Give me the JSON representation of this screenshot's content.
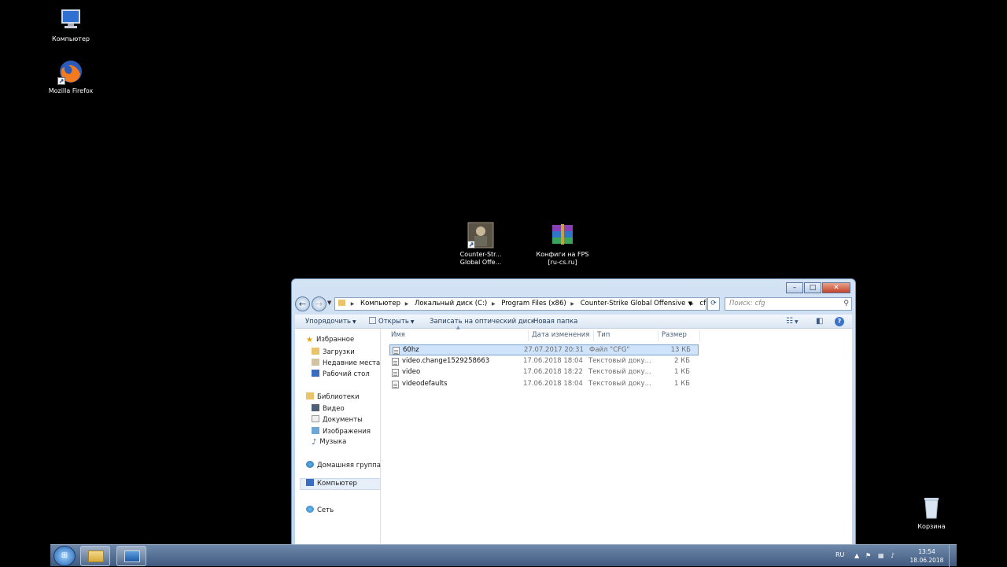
{
  "desktop": {
    "icons": [
      {
        "label": "Компьютер"
      },
      {
        "label": "Mozilla Firefox"
      },
      {
        "label": "Counter-Str... Global Offe..."
      },
      {
        "label": "Конфиги на FPS [ru-cs.ru]"
      },
      {
        "label": "Корзина"
      }
    ]
  },
  "window": {
    "address": {
      "segments": [
        "Компьютер",
        "Локальный диск (C:)",
        "Program Files (x86)",
        "Counter-Strike Global Offensive",
        "cfg"
      ]
    },
    "search_placeholder": "Поиск: cfg",
    "toolbar": {
      "organize": "Упорядочить",
      "open": "Открыть",
      "burn": "Записать на оптический диск",
      "new_folder": "Новая папка"
    },
    "nav": {
      "favorites": "Избранное",
      "downloads": "Загрузки",
      "recent": "Недавние места",
      "desktop": "Рабочий стол",
      "libraries": "Библиотеки",
      "video": "Видео",
      "documents": "Документы",
      "images": "Изображения",
      "music": "Музыка",
      "homegroup": "Домашняя группа",
      "computer": "Компьютер",
      "network": "Сеть"
    },
    "columns": {
      "name": "Имя",
      "date": "Дата изменения",
      "type": "Тип",
      "size": "Размер"
    },
    "files": [
      {
        "name": "60hz",
        "date": "27.07.2017 20:31",
        "type": "Файл \"CFG\"",
        "size": "13 КБ"
      },
      {
        "name": "video.change1529258663",
        "date": "17.06.2018 18:04",
        "type": "Текстовый доку...",
        "size": "2 КБ"
      },
      {
        "name": "video",
        "date": "17.06.2018 18:22",
        "type": "Текстовый доку...",
        "size": "1 КБ"
      },
      {
        "name": "videodefaults",
        "date": "17.06.2018 18:04",
        "type": "Текстовый доку...",
        "size": "1 КБ"
      }
    ]
  },
  "taskbar": {
    "lang": "RU",
    "time": "13:54",
    "date": "18.06.2018"
  },
  "colors": {
    "selection": "#cfe3fb",
    "titlebar": "#c8dbf0",
    "taskbar": "#4f6a90"
  }
}
